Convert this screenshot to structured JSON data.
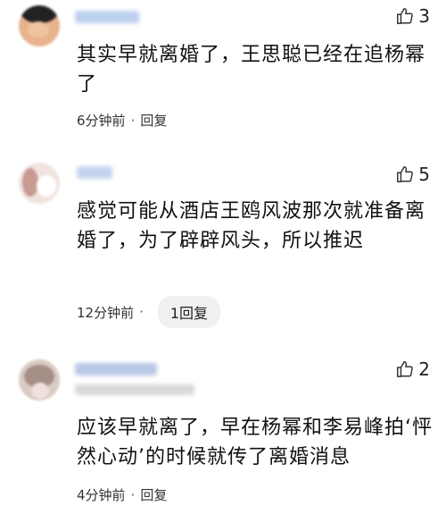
{
  "comments": [
    {
      "likes": "3",
      "text": "其实早就离婚了，王思聪已经在追杨幂了",
      "time": "6分钟前",
      "reply": "回复"
    },
    {
      "likes": "5",
      "text": "感觉可能从酒店王鸥风波那次就准备离婚了，为了辟辟风头，所以推迟",
      "time": "12分钟前",
      "reply": "1回复"
    },
    {
      "likes": "2",
      "text": "应该早就离了，早在杨幂和李易峰拍‘怦然心动’的时候就传了离婚消息",
      "time": "4分钟前",
      "reply": "回复"
    }
  ],
  "colors": {
    "name_blur": "#b8c8e6",
    "text": "#111111",
    "pill_bg": "#f0f0f0"
  },
  "icons": {
    "like": "thumbs-up-icon"
  }
}
